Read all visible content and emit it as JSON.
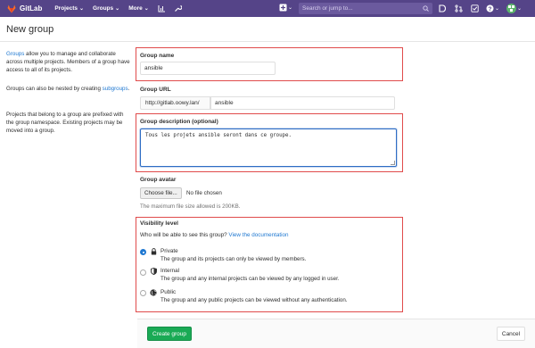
{
  "navbar": {
    "brand": "GitLab",
    "menu": [
      {
        "label": "Projects"
      },
      {
        "label": "Groups"
      },
      {
        "label": "More"
      }
    ],
    "search_placeholder": "Search or jump to..."
  },
  "page": {
    "title": "New group"
  },
  "sidebar": {
    "p1_link": "Groups",
    "p1_text": " allow you to manage and collaborate across multiple projects. Members of a group have access to all of its projects.",
    "p2_text": "Groups can also be nested by creating ",
    "p2_link": "subgroups",
    "p2_end": ".",
    "p3_text": "Projects that belong to a group are prefixed with the group namespace. Existing projects may be moved into a group."
  },
  "form": {
    "group_name_label": "Group name",
    "group_name_value": "ansible",
    "group_url_label": "Group URL",
    "group_url_prefix": "http://gitlab.oowy.lan/",
    "group_url_value": "ansible",
    "description_label": "Group description (optional)",
    "description_value": "Tous les projets ansible seront dans ce groupe.",
    "avatar_label": "Group avatar",
    "choose_file": "Choose file...",
    "no_file": "No file chosen",
    "avatar_help": "The maximum file size allowed is 200KB.",
    "visibility_label": "Visibility level",
    "visibility_question": "Who will be able to see this group?",
    "visibility_doc_link": "View the documentation",
    "visibility_options": [
      {
        "title": "Private",
        "desc": "The group and its projects can only be viewed by members.",
        "selected": true,
        "icon": "lock-icon"
      },
      {
        "title": "Internal",
        "desc": "The group and any internal projects can be viewed by any logged in user.",
        "selected": false,
        "icon": "shield-icon"
      },
      {
        "title": "Public",
        "desc": "The group and any public projects can be viewed without any authentication.",
        "selected": false,
        "icon": "globe-icon"
      }
    ]
  },
  "actions": {
    "create": "Create group",
    "cancel": "Cancel"
  },
  "colors": {
    "navbar": "#554488",
    "link": "#1f78d1",
    "create_button": "#1aaa55",
    "highlight_box": "#e04b4b"
  }
}
